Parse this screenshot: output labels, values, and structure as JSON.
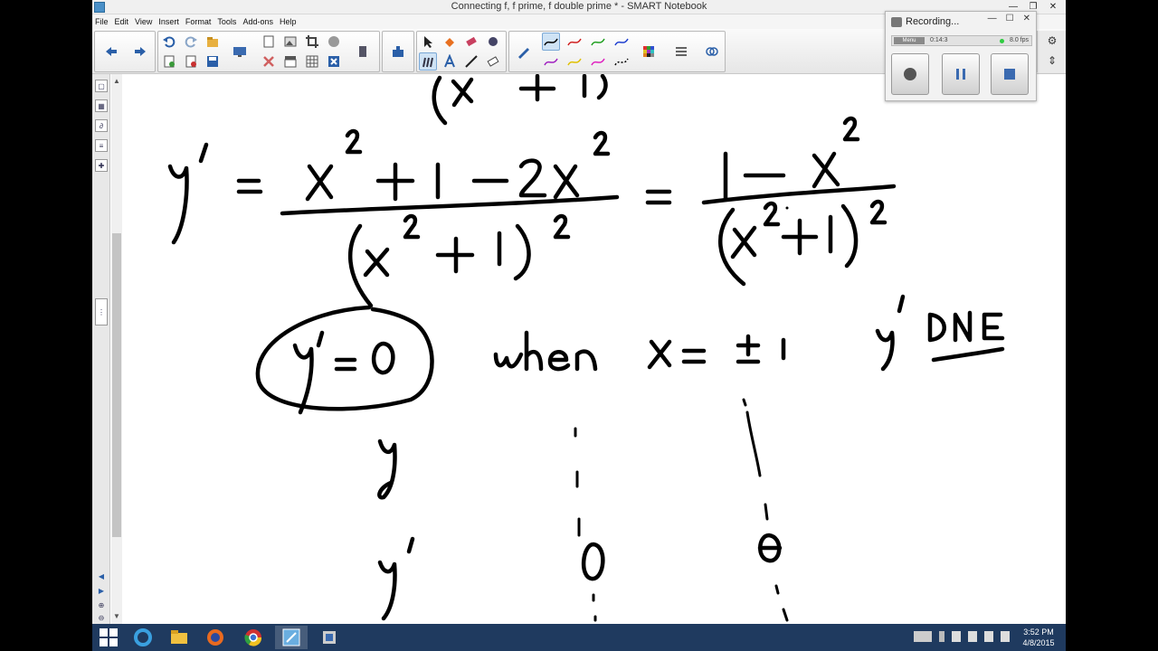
{
  "window": {
    "title": "Connecting f, f prime, f double prime * - SMART Notebook",
    "minimize": "—",
    "restore": "❐",
    "close": "✕"
  },
  "menu": [
    "File",
    "Edit",
    "View",
    "Insert",
    "Format",
    "Tools",
    "Add-ons",
    "Help"
  ],
  "recorder": {
    "title": "Recording...",
    "mode": "Menu",
    "time": "0:14:3",
    "fps": "8.0 fps",
    "minimize": "—",
    "maximize": "☐",
    "close": "✕"
  },
  "taskbar": {
    "time": "3:52 PM",
    "date": "4/8/2015"
  },
  "colors": {
    "accent": "#4a90c8",
    "taskbar": "#1f3a5f",
    "ink": "#000000",
    "record_green": "#2ecc40"
  },
  "icons": {
    "toolbar": [
      "back-icon",
      "forward-icon",
      "undo-icon",
      "redo-icon",
      "open-icon",
      "screen-icon",
      "page-icon",
      "table-icon",
      "crop-icon",
      "add-page-icon",
      "delete-icon",
      "magic-icon",
      "select-icon",
      "fill-icon",
      "eraser-icon",
      "pen-icon",
      "text-icon",
      "line-icon",
      "shape-icon",
      "color-icon",
      "properties-icon",
      "attach-icon"
    ]
  }
}
